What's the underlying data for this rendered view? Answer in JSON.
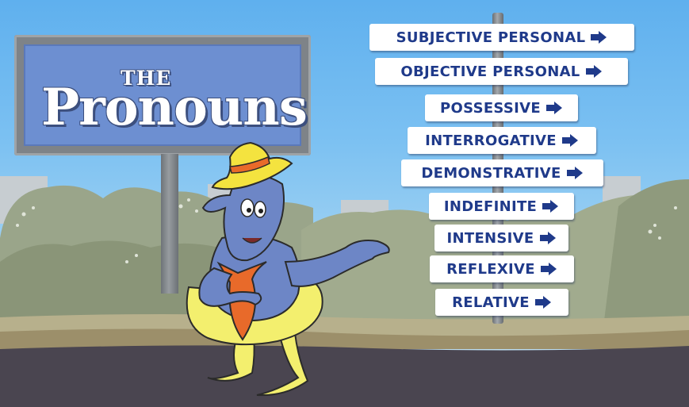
{
  "billboard": {
    "small_title": "THE",
    "main_title": "Pronouns"
  },
  "signs": [
    {
      "label": "SUBJECTIVE PERSONAL",
      "icon": "arrow-right-icon"
    },
    {
      "label": "OBJECTIVE PERSONAL",
      "icon": "arrow-right-icon"
    },
    {
      "label": "POSSESSIVE",
      "icon": "arrow-right-icon"
    },
    {
      "label": "INTERROGATIVE",
      "icon": "arrow-right-icon"
    },
    {
      "label": "DEMONSTRATIVE",
      "icon": "arrow-right-icon"
    },
    {
      "label": "INDEFINITE",
      "icon": "arrow-right-icon"
    },
    {
      "label": "INTENSIVE",
      "icon": "arrow-right-icon"
    },
    {
      "label": "REFLEXIVE",
      "icon": "arrow-right-icon"
    },
    {
      "label": "RELATIVE",
      "icon": "arrow-right-icon"
    }
  ],
  "colors": {
    "sign_text": "#1f3a8a",
    "sign_background": "#ffffff",
    "billboard_panel": "#6d8fd1",
    "character_skin": "#6d86c6",
    "character_body": "#f3ef6e",
    "hat": "#f4e33f",
    "tie": "#e86a2a",
    "road": "#4a4550"
  }
}
